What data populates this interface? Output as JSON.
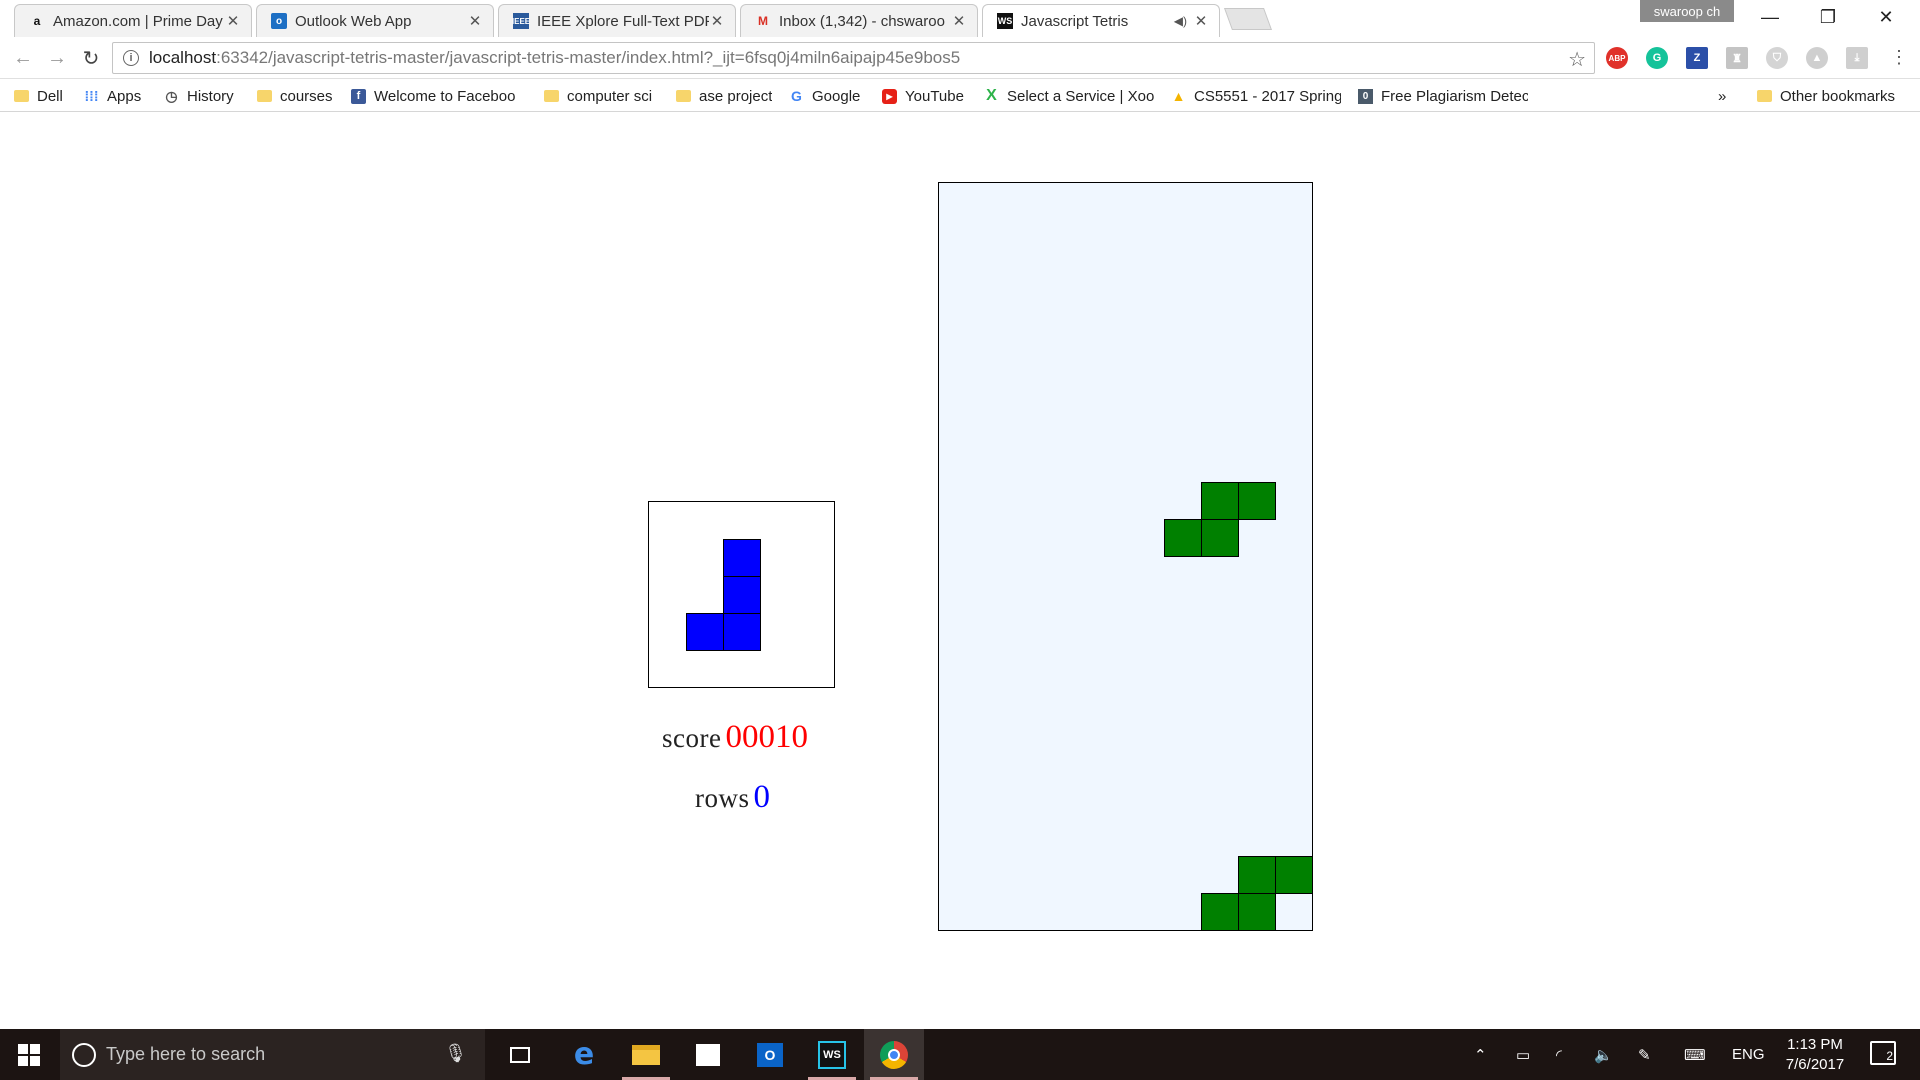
{
  "tabs": [
    {
      "title": "Amazon.com | Prime Day",
      "icon": "amazon-icon",
      "active": false
    },
    {
      "title": "Outlook Web App",
      "icon": "outlook-icon",
      "active": false
    },
    {
      "title": "IEEE Xplore Full-Text PDF",
      "icon": "ieee-icon",
      "active": false
    },
    {
      "title": "Inbox (1,342) - chswaroo",
      "icon": "gmail-icon",
      "active": false
    },
    {
      "title": "Javascript Tetris",
      "icon": "webstorm-icon",
      "active": true
    }
  ],
  "window": {
    "profile_name": "swaroop ch"
  },
  "address_bar": {
    "host": "localhost",
    "path": ":63342/javascript-tetris-master/javascript-tetris-master/index.html?_ijt=6fsq0j4miln6aipajp45e9bos5"
  },
  "bookmarks": [
    {
      "label": "Dell",
      "icon": "folder-icon"
    },
    {
      "label": "Apps",
      "icon": "apps-grid-icon"
    },
    {
      "label": "History",
      "icon": "history-icon"
    },
    {
      "label": "courses",
      "icon": "folder-icon"
    },
    {
      "label": "Welcome to Faceboo",
      "icon": "facebook-icon"
    },
    {
      "label": "computer sci",
      "icon": "folder-icon"
    },
    {
      "label": "ase project",
      "icon": "folder-icon"
    },
    {
      "label": "Google",
      "icon": "google-icon"
    },
    {
      "label": "YouTube",
      "icon": "youtube-icon"
    },
    {
      "label": "Select a Service | Xoo",
      "icon": "xoom-icon"
    },
    {
      "label": "CS5551 - 2017 Spring",
      "icon": "drive-icon"
    },
    {
      "label": "Free Plagiarism Detec",
      "icon": "plagiarism-icon"
    }
  ],
  "bookmarks_overflow": "»",
  "other_bookmarks": "Other bookmarks",
  "game": {
    "score_label": "score",
    "score_value": "00010",
    "rows_label": "rows",
    "rows_value": "0",
    "colors": {
      "next_piece": "#0000ff",
      "board_pieces": "#008000",
      "board_bg": "#f0f7ff",
      "score": "#ff0000",
      "rows": "#0000ff"
    }
  },
  "taskbar": {
    "search_placeholder": "Type here to search",
    "language": "ENG",
    "time": "1:13 PM",
    "date": "7/6/2017",
    "notification_count": "2"
  }
}
